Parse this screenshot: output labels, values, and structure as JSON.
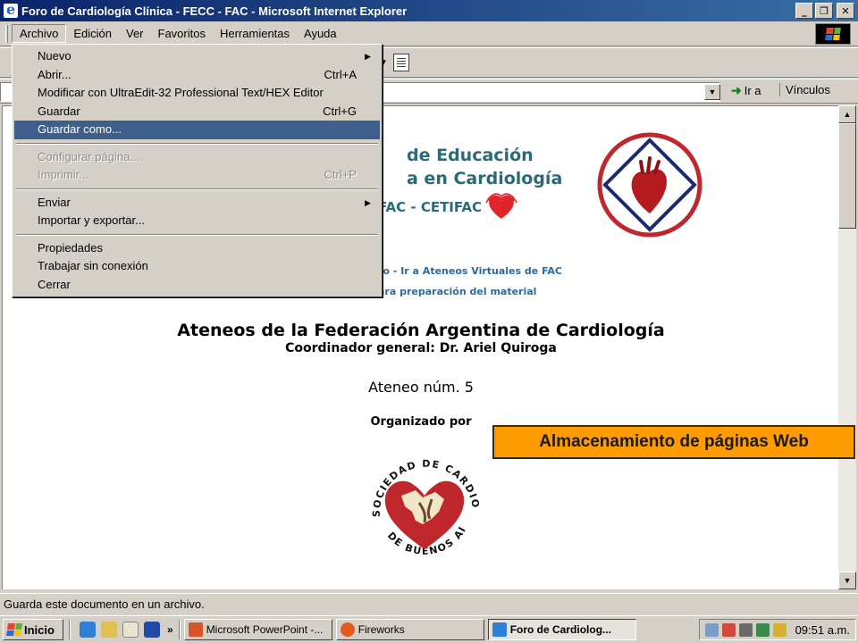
{
  "window": {
    "title": "Foro de Cardiología Clínica - FECC - FAC - Microsoft Internet Explorer",
    "buttons": {
      "minimize": "_",
      "maximize": "❐",
      "close": "✕"
    }
  },
  "menubar": {
    "items": [
      "Archivo",
      "Edición",
      "Ver",
      "Favoritos",
      "Herramientas",
      "Ayuda"
    ]
  },
  "dropdown": {
    "items": [
      {
        "label": "Nuevo",
        "shortcut": "",
        "submenu": true
      },
      {
        "label": "Abrir...",
        "shortcut": "Ctrl+A"
      },
      {
        "label": "Modificar con UltraEdit-32 Professional Text/HEX Editor",
        "shortcut": ""
      },
      {
        "label": "Guardar",
        "shortcut": "Ctrl+G"
      },
      {
        "label": "Guardar como...",
        "shortcut": "",
        "highlighted": true
      },
      {
        "label": "Configurar página...",
        "shortcut": "",
        "disabled": true
      },
      {
        "label": "Imprimir...",
        "shortcut": "Ctrl+P",
        "disabled": true
      },
      {
        "label": "Enviar",
        "shortcut": "",
        "submenu": true
      },
      {
        "label": "Importar y exportar...",
        "shortcut": ""
      },
      {
        "label": "Propiedades",
        "shortcut": ""
      },
      {
        "label": "Trabajar sin conexión",
        "shortcut": ""
      },
      {
        "label": "Cerrar",
        "shortcut": ""
      }
    ]
  },
  "addressbar": {
    "go_label": "Ir a",
    "links_label": "Vínculos"
  },
  "page": {
    "edu_line1": "de Educación",
    "edu_line2": "a en Cardiología",
    "cetifac": "FAC - CETIFAC",
    "link1": "ro - Ir a Ateneos Virtuales de FAC",
    "link2": "ara preparación del material",
    "main_title": "Ateneos de la Federación Argentina de Cardiología",
    "coordinator": "Coordinador general: Dr. Ariel Quiroga",
    "ateneo": "Ateneo núm. 5",
    "organized_by": "Organizado por",
    "sca_ring_text": "SOCIEDAD DE CARDIOLOGIA",
    "sca_bottom_text": "DE BUENOS AIRES"
  },
  "callout": {
    "text": "Almacenamiento de páginas Web",
    "color": "#fe9b00"
  },
  "statusbar": {
    "text": "Guarda este documento en un archivo."
  },
  "taskbar": {
    "start": "Inicio",
    "quicklaunch_more": "»",
    "tasks": [
      {
        "label": "Microsoft PowerPoint -...",
        "icon": "powerpoint-icon"
      },
      {
        "label": "Fireworks",
        "icon": "fireworks-icon"
      },
      {
        "label": "Foro de Cardiolog...",
        "icon": "ie-icon",
        "active": true
      }
    ],
    "clock": "09:51 a.m."
  },
  "colors": {
    "titlebar_start": "#0a246a",
    "menu_highlight": "#3e5f8c",
    "page_teal": "#2b6a78",
    "logo_red": "#c0272d"
  }
}
